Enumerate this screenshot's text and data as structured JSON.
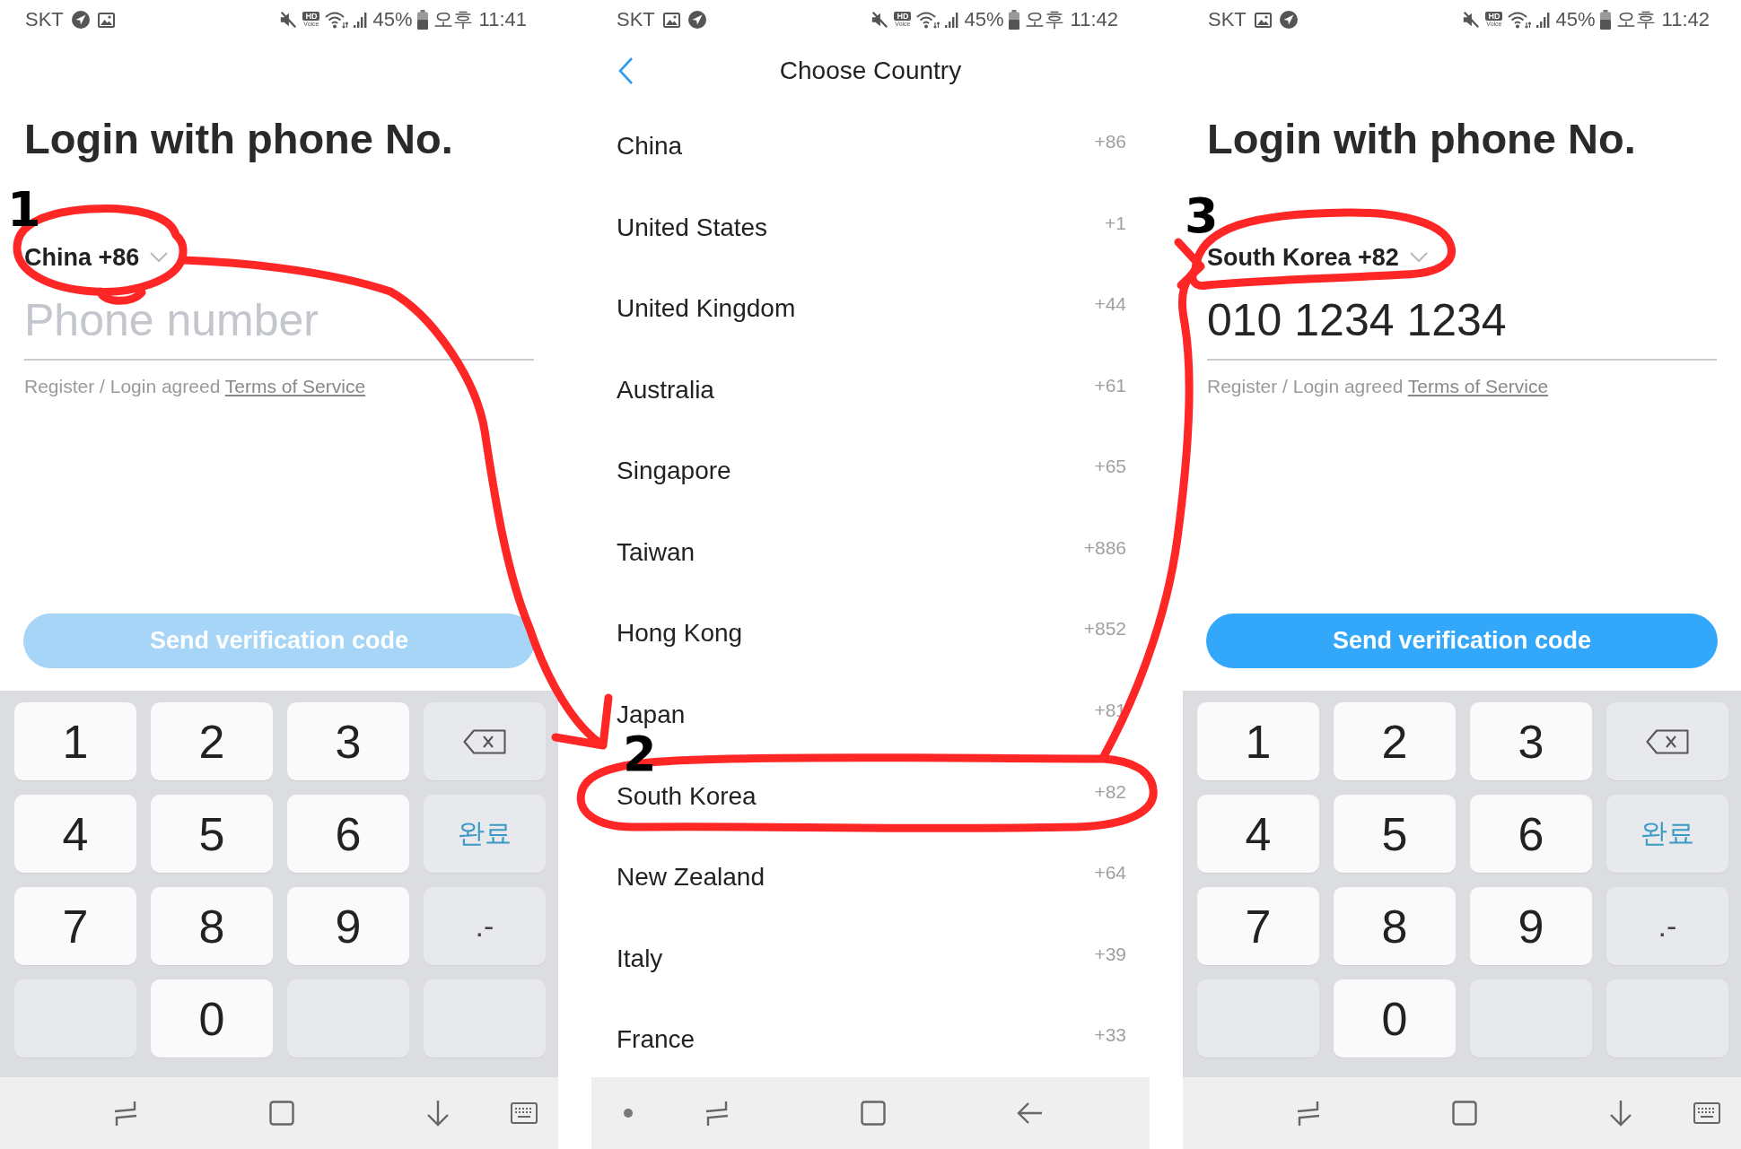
{
  "screens": [
    {
      "kind": "login",
      "status_bar": {
        "carrier": "SKT",
        "notifications": [
          {
            "kind": "navigation"
          },
          {
            "kind": "picture"
          }
        ],
        "hd_voice": {
          "badge": "HD",
          "label": "Voice"
        },
        "battery": "45%",
        "time": "오후 11:41"
      },
      "title": "Login with phone No.",
      "country_selector": {
        "label": "China +86"
      },
      "phone_field": {
        "placeholder": "Phone number"
      },
      "terms": {
        "text": "Register / Login agreed",
        "link": "Terms of Service"
      },
      "send_button": {
        "label": "Send verification code",
        "disabled": true
      },
      "keypad": [
        {
          "kind": "digit",
          "label": "1"
        },
        {
          "kind": "digit",
          "label": "2"
        },
        {
          "kind": "digit",
          "label": "3"
        },
        {
          "kind": "backspace"
        },
        {
          "kind": "digit",
          "label": "4"
        },
        {
          "kind": "digit",
          "label": "5"
        },
        {
          "kind": "digit",
          "label": "6"
        },
        {
          "kind": "done",
          "label": "완료"
        },
        {
          "kind": "digit",
          "label": "7"
        },
        {
          "kind": "digit",
          "label": "8"
        },
        {
          "kind": "digit",
          "label": "9"
        },
        {
          "kind": "symbol",
          "label": ".-"
        },
        {
          "kind": "blank"
        },
        {
          "kind": "digit",
          "label": "0"
        },
        {
          "kind": "blank"
        },
        {
          "kind": "blank"
        }
      ],
      "nav_bar": [
        {
          "kind": "recents"
        },
        {
          "kind": "home"
        },
        {
          "kind": "hide_keyboard"
        },
        {
          "kind": "keyboard"
        }
      ]
    },
    {
      "kind": "country_list",
      "status_bar": {
        "carrier": "SKT",
        "notifications": [
          {
            "kind": "picture"
          },
          {
            "kind": "navigation"
          }
        ],
        "hd_voice": {
          "badge": "HD",
          "label": "Voice"
        },
        "battery": "45%",
        "time": "오후 11:42"
      },
      "header": {
        "title": "Choose Country"
      },
      "countries": [
        {
          "name": "China",
          "code": "+86"
        },
        {
          "name": "United States",
          "code": "+1"
        },
        {
          "name": "United Kingdom",
          "code": "+44"
        },
        {
          "name": "Australia",
          "code": "+61"
        },
        {
          "name": "Singapore",
          "code": "+65"
        },
        {
          "name": "Taiwan",
          "code": "+886"
        },
        {
          "name": "Hong Kong",
          "code": "+852"
        },
        {
          "name": "Japan",
          "code": "+81"
        },
        {
          "name": "South Korea",
          "code": "+82"
        },
        {
          "name": "New Zealand",
          "code": "+64"
        },
        {
          "name": "Italy",
          "code": "+39"
        },
        {
          "name": "France",
          "code": "+33"
        }
      ],
      "nav_bar": [
        {
          "kind": "dot"
        },
        {
          "kind": "recents"
        },
        {
          "kind": "home"
        },
        {
          "kind": "back"
        }
      ]
    },
    {
      "kind": "login",
      "status_bar": {
        "carrier": "SKT",
        "notifications": [
          {
            "kind": "picture"
          },
          {
            "kind": "navigation"
          }
        ],
        "hd_voice": {
          "badge": "HD",
          "label": "Voice"
        },
        "battery": "45%",
        "time": "오후 11:42"
      },
      "title": "Login with phone No.",
      "country_selector": {
        "label": "South Korea +82"
      },
      "phone_field": {
        "value": "010 1234 1234"
      },
      "terms": {
        "text": "Register / Login agreed",
        "link": "Terms of Service"
      },
      "send_button": {
        "label": "Send verification code",
        "disabled": false
      },
      "keypad": [
        {
          "kind": "digit",
          "label": "1"
        },
        {
          "kind": "digit",
          "label": "2"
        },
        {
          "kind": "digit",
          "label": "3"
        },
        {
          "kind": "backspace"
        },
        {
          "kind": "digit",
          "label": "4"
        },
        {
          "kind": "digit",
          "label": "5"
        },
        {
          "kind": "digit",
          "label": "6"
        },
        {
          "kind": "done",
          "label": "완료"
        },
        {
          "kind": "digit",
          "label": "7"
        },
        {
          "kind": "digit",
          "label": "8"
        },
        {
          "kind": "digit",
          "label": "9"
        },
        {
          "kind": "symbol",
          "label": ".-"
        },
        {
          "kind": "blank"
        },
        {
          "kind": "digit",
          "label": "0"
        },
        {
          "kind": "blank"
        },
        {
          "kind": "blank"
        }
      ],
      "nav_bar": [
        {
          "kind": "recents"
        },
        {
          "kind": "home"
        },
        {
          "kind": "hide_keyboard"
        },
        {
          "kind": "keyboard"
        }
      ]
    }
  ],
  "annotations": [
    {
      "label": "1"
    },
    {
      "label": "2"
    },
    {
      "label": "3"
    }
  ]
}
